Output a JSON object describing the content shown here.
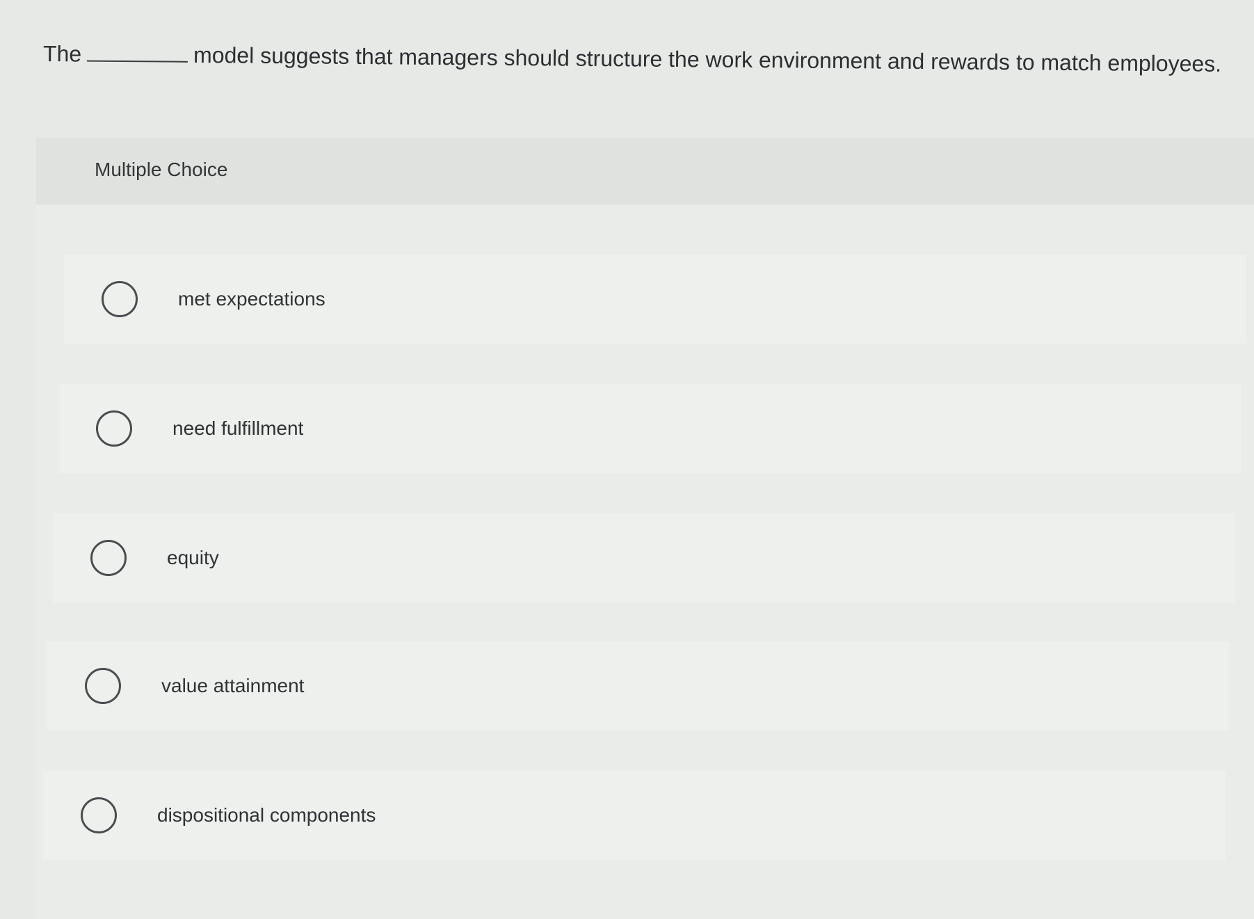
{
  "question": {
    "prefix": "The",
    "suffix": "model suggests that managers should structure the work environment and rewards to match employees."
  },
  "panel": {
    "title": "Multiple Choice"
  },
  "options": [
    {
      "label": "met expectations"
    },
    {
      "label": "need fulfillment"
    },
    {
      "label": "equity"
    },
    {
      "label": "value attainment"
    },
    {
      "label": "dispositional components"
    }
  ]
}
